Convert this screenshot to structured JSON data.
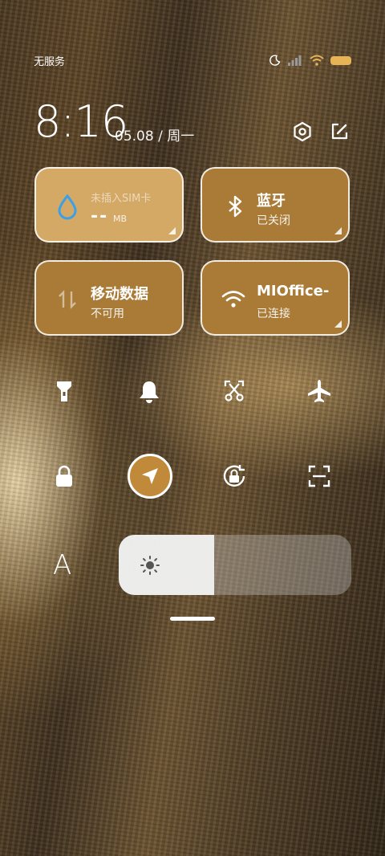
{
  "status_bar": {
    "carrier": "无服务",
    "icons": [
      "moon-icon",
      "signal-icon",
      "wifi-icon",
      "battery-icon"
    ],
    "battery_color": "#e7b357"
  },
  "clock": {
    "time": "8:16",
    "date": "05.08 / 周一"
  },
  "header_buttons": [
    "settings-icon",
    "edit-icon"
  ],
  "tiles": {
    "data_usage": {
      "title": "未插入SIM卡",
      "value": "--",
      "unit": "MB",
      "icon": "water-drop-icon"
    },
    "bluetooth": {
      "title": "蓝牙",
      "status": "已关闭",
      "icon": "bluetooth-icon"
    },
    "mobile_data": {
      "title": "移动数据",
      "status": "不可用",
      "icon": "data-arrows-icon"
    },
    "wifi": {
      "title": "MIOffice-",
      "status": "已连接",
      "icon": "wifi-icon"
    }
  },
  "toggles_row1": [
    "flashlight-icon",
    "bell-icon",
    "screenshot-scissors-icon",
    "airplane-icon"
  ],
  "toggles_row2": [
    "lock-icon",
    "location-icon",
    "rotation-lock-icon",
    "scan-icon"
  ],
  "location_active_color": "#c08a3a",
  "brightness": {
    "level": 0.41,
    "auto_label": "A"
  },
  "colors": {
    "tile_light": "#d4a865",
    "tile_gold": "#a97b36",
    "sim_blue": "#3aa0e8"
  }
}
